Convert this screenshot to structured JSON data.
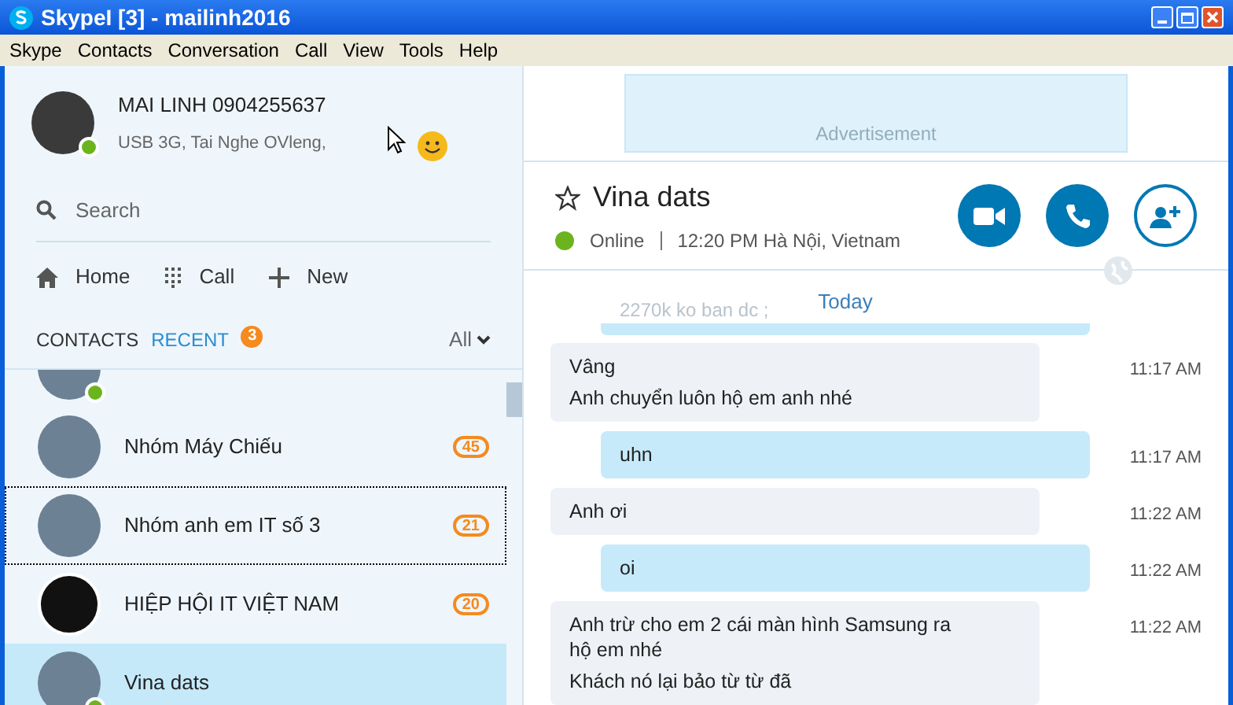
{
  "window": {
    "title": "SkypeI [3] - mailinh2016"
  },
  "menu": [
    "Skype",
    "Contacts",
    "Conversation",
    "Call",
    "View",
    "Tools",
    "Help"
  ],
  "profile": {
    "name": "MAI LINH 0904255637",
    "mood": "USB 3G, Tai Nghe OVleng,",
    "online": true
  },
  "search": {
    "placeholder": "Search"
  },
  "nav": [
    {
      "label": "Home",
      "kind": "home"
    },
    {
      "label": "Call",
      "kind": "dialpad"
    },
    {
      "label": "New",
      "kind": "plus"
    }
  ],
  "tabs": [
    {
      "label": "CONTACTS",
      "selected": false
    },
    {
      "label": "RECENT",
      "selected": true,
      "badge": "3"
    }
  ],
  "filter": "All",
  "contacts": [
    {
      "online": true,
      "selected": false,
      "focused": false
    },
    {
      "name": "Nhóm Máy Chiếu",
      "count": "45",
      "online": false,
      "selected": false,
      "focused": false
    },
    {
      "name": "Nhóm anh em IT số 3",
      "count": "21",
      "online": false,
      "selected": false,
      "focused": true
    },
    {
      "name": "HIỆP HỘI IT VIỆT NAM",
      "count": "20",
      "online": false,
      "selected": false,
      "focused": false
    },
    {
      "name": "Vina dats",
      "online": true,
      "selected": true,
      "focused": false
    }
  ],
  "ad": "Advertisement",
  "conversation": {
    "name": "Vina dats",
    "status": "Online",
    "info": "12:20 PM Hà Nội, Vietnam",
    "online": true
  },
  "day": "Today",
  "faded_message": "2270k ko ban dc ;",
  "messages": [
    {
      "lines": [
        "Vâng",
        "Anh chuyển luôn hộ em anh nhé"
      ],
      "time": "11:17 AM",
      "outgoing": false
    },
    {
      "lines": [
        "uhn"
      ],
      "time": "11:17 AM",
      "outgoing": true
    },
    {
      "lines": [
        "Anh ơi"
      ],
      "time": "11:22 AM",
      "outgoing": false
    },
    {
      "lines": [
        "oi"
      ],
      "time": "11:22 AM",
      "outgoing": true
    },
    {
      "lines": [
        "Anh trừ cho em 2 cái màn hình Samsung ra hộ em nhé",
        "Khách nó lại bảo từ từ đã"
      ],
      "time": "11:22 AM",
      "outgoing": false
    }
  ]
}
